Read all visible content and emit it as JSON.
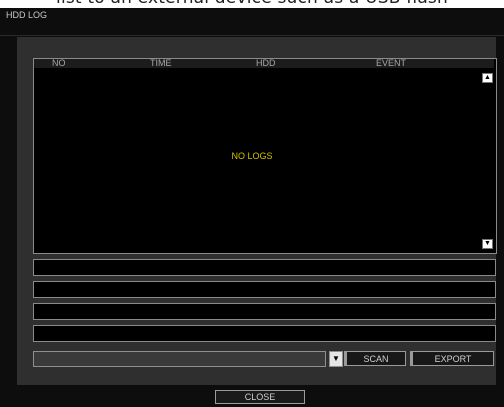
{
  "caption": "list to an external device such as a USB flash",
  "window": {
    "title": "HDD LOG"
  },
  "list": {
    "columns": [
      "NO",
      "TIME",
      "HDD",
      "EVENT"
    ],
    "empty_message": "NO LOGS",
    "scroll_up_icon": "triangle-up-icon",
    "scroll_down_icon": "triangle-down-icon"
  },
  "detail_fields": [
    "",
    "",
    "",
    ""
  ],
  "device_select": {
    "value": "",
    "arrow_icon": "chevron-down-icon"
  },
  "buttons": {
    "scan": "SCAN",
    "export": "EXPORT",
    "close": "CLOSE"
  },
  "colors": {
    "window_bg": "#0d0d0d",
    "panel_bg": "#2f2f2f",
    "empty_text": "#d6c000"
  }
}
